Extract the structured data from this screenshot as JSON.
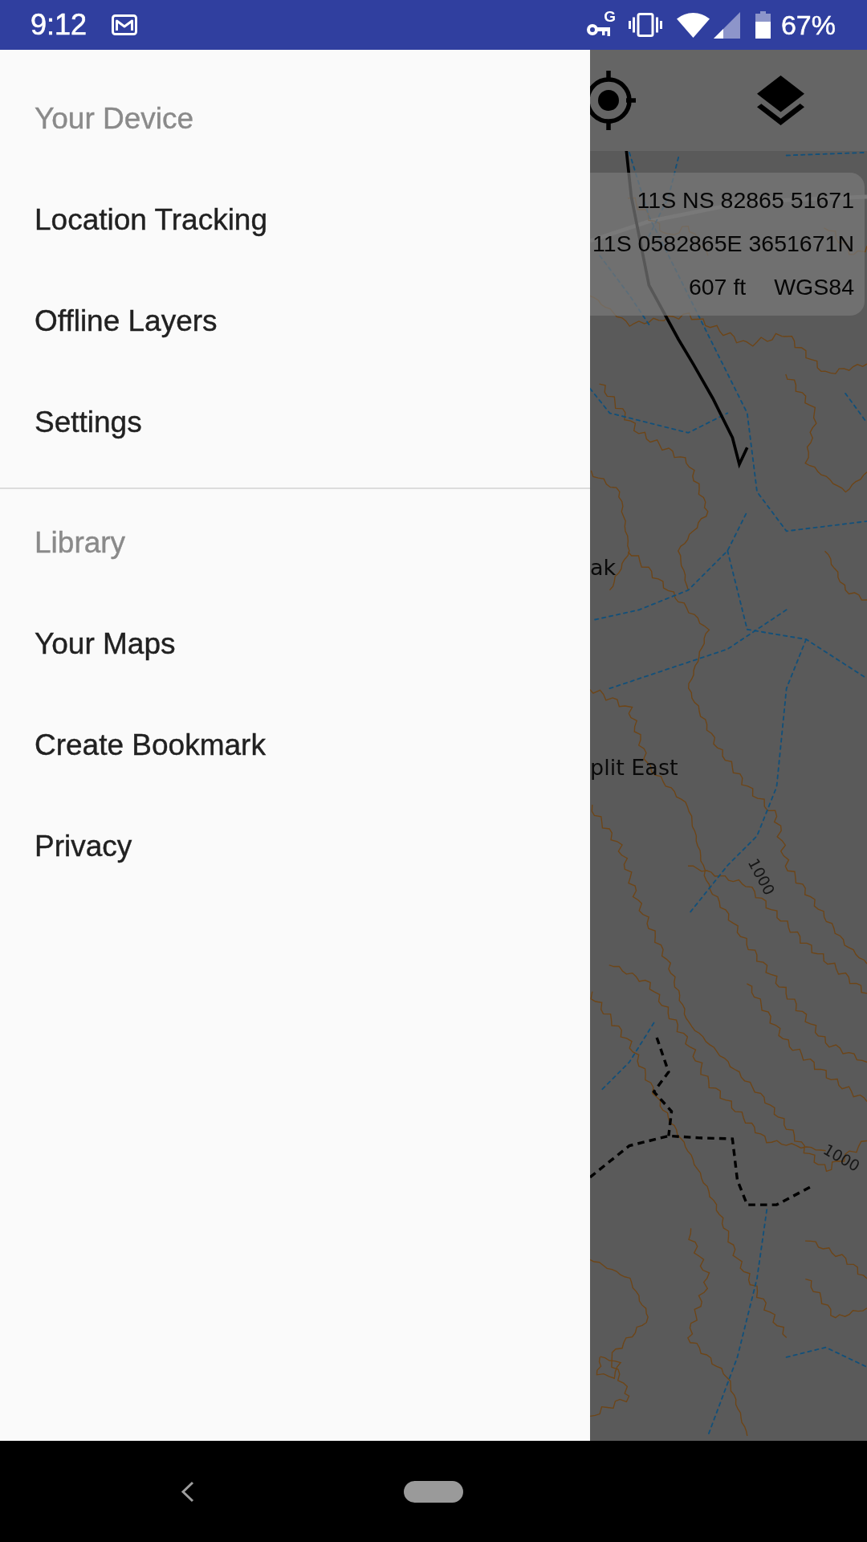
{
  "status_bar": {
    "time": "9:12",
    "vpn_letter": "G",
    "battery": "67%"
  },
  "drawer": {
    "sections": [
      {
        "header": "Your Device",
        "items": [
          {
            "label": "Location Tracking"
          },
          {
            "label": "Offline Layers"
          },
          {
            "label": "Settings"
          }
        ]
      },
      {
        "header": "Library",
        "items": [
          {
            "label": "Your Maps"
          },
          {
            "label": "Create Bookmark"
          },
          {
            "label": "Privacy"
          }
        ]
      }
    ]
  },
  "map": {
    "coordinates": {
      "lines": [
        "11S NS 82865 51671",
        "11S 0582865E 3651671N"
      ],
      "elevation": "607 ft",
      "datum": "WGS84"
    },
    "labels": [
      "ak",
      "plit East",
      "1000",
      "1000"
    ]
  }
}
